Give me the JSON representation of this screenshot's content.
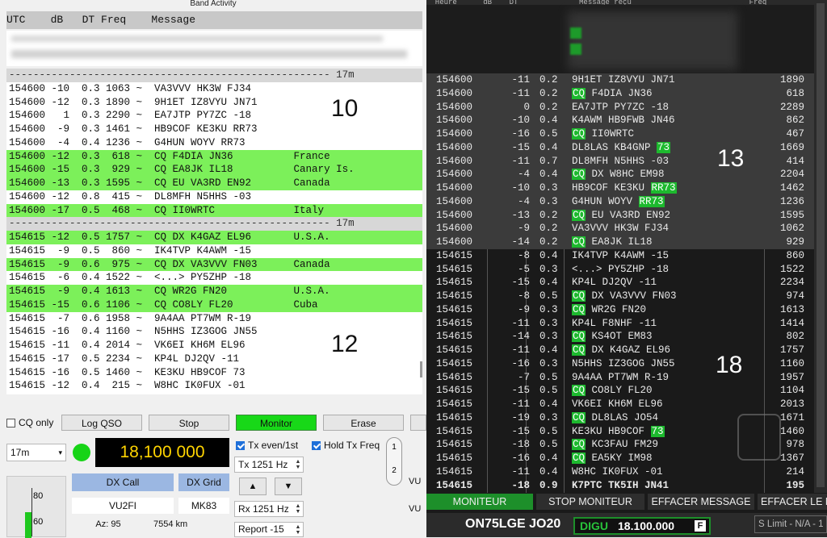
{
  "left": {
    "title": "Band Activity",
    "header": "UTC    dB   DT Freq    Message",
    "rows": [
      {
        "t": "----------------------------------------------------- 17m",
        "k": "sep"
      },
      {
        "t": "154600 -10  0.3 1063 ~  VA3VVV HK3W FJ34",
        "k": ""
      },
      {
        "t": "154600 -12  0.3 1890 ~  9H1ET IZ8VYU JN71",
        "k": ""
      },
      {
        "t": "154600   1  0.3 2290 ~  EA7JTP PY7ZC -18",
        "k": ""
      },
      {
        "t": "154600  -9  0.3 1461 ~  HB9COF KE3KU RR73",
        "k": ""
      },
      {
        "t": "154600  -4  0.4 1236 ~  G4HUN WOYV RR73",
        "k": ""
      },
      {
        "t": "154600 -12  0.3  618 ~  CQ F4DIA JN36          France",
        "k": "cq"
      },
      {
        "t": "154600 -15  0.3  929 ~  CQ EA8JK IL18          Canary Is.",
        "k": "cq"
      },
      {
        "t": "154600 -13  0.3 1595 ~  CQ EU VA3RD EN92       Canada",
        "k": "cq"
      },
      {
        "t": "154600 -12  0.8  415 ~  DL8MFH N5HHS -03",
        "k": ""
      },
      {
        "t": "154600 -17  0.5  468 ~  CQ II0WRTC             Italy",
        "k": "cq"
      },
      {
        "t": "----------------------------------------------------- 17m",
        "k": "sep"
      },
      {
        "t": "154615 -12  0.5 1757 ~  CQ DX K4GAZ EL96       U.S.A.",
        "k": "cq"
      },
      {
        "t": "154615  -9  0.5  860 ~  IK4TVP K4AWM -15",
        "k": ""
      },
      {
        "t": "154615  -9  0.6  975 ~  CQ DX VA3VVV FN03      Canada",
        "k": "cq"
      },
      {
        "t": "154615  -6  0.4 1522 ~  <...> PY5ZHP -18",
        "k": ""
      },
      {
        "t": "154615  -9  0.4 1613 ~  CQ WR2G FN20           U.S.A.",
        "k": "cq"
      },
      {
        "t": "154615 -15  0.6 1106 ~  CQ CO8LY FL20          Cuba",
        "k": "cq"
      },
      {
        "t": "154615  -7  0.6 1958 ~  9A4AA PT7WM R-19",
        "k": ""
      },
      {
        "t": "154615 -16  0.4 1160 ~  N5HHS IZ3GOG JN55",
        "k": ""
      },
      {
        "t": "154615 -11  0.4 2014 ~  VK6EI KH6M EL96",
        "k": ""
      },
      {
        "t": "154615 -17  0.5 2234 ~  KP4L DJ2QV -11",
        "k": ""
      },
      {
        "t": "154615 -16  0.5 1460 ~  KE3KU HB9COF 73",
        "k": ""
      },
      {
        "t": "154615 -12  0.4  215 ~  W8HC IK0FUX -01",
        "k": ""
      }
    ],
    "n10": "10",
    "n12": "12",
    "cq_only": "CQ only",
    "log_qso": "Log QSO",
    "stop": "Stop",
    "monitor": "Monitor",
    "erase": "Erase",
    "band": "17m",
    "freq": "18,100 000",
    "tx_even": "Tx even/1st",
    "hold_tx": "Hold Tx Freq",
    "tx": "Tx  1251 Hz",
    "rx": "Rx  1251 Hz",
    "report": "Report -15",
    "dx_call_lbl": "DX Call",
    "dx_grid_lbl": "DX Grid",
    "dx_call": "VU2FI",
    "dx_grid": "MK83",
    "az": "Az: 95",
    "dist": "7554 km",
    "meter_80": "80",
    "meter_60": "60",
    "tab_1": "1",
    "tab_2": "2",
    "vu": "VU"
  },
  "right": {
    "colhdr": "  Heure      dB    DT              Message reçu                           Fréq",
    "rows": [
      {
        "u": "154600",
        "db": "-11",
        "dt": "0.2",
        "m": [
          {
            "x": "9H1ET IZ8VYU JN71"
          }
        ],
        "f": "1890",
        "h": true
      },
      {
        "u": "154600",
        "db": "-11",
        "dt": "0.2",
        "m": [
          {
            "x": "CQ",
            "g": true
          },
          {
            "x": " F4DIA JN36"
          }
        ],
        "f": "618",
        "h": true
      },
      {
        "u": "154600",
        "db": "0",
        "dt": "0.2",
        "m": [
          {
            "x": "EA7JTP PY7ZC -18"
          }
        ],
        "f": "2289",
        "h": true
      },
      {
        "u": "154600",
        "db": "-10",
        "dt": "0.4",
        "m": [
          {
            "x": "K4AWM HB9FWB JN46"
          }
        ],
        "f": "862",
        "h": true
      },
      {
        "u": "154600",
        "db": "-16",
        "dt": "0.5",
        "m": [
          {
            "x": "CQ",
            "g": true
          },
          {
            "x": " II0WRTC"
          }
        ],
        "f": "467",
        "h": true
      },
      {
        "u": "154600",
        "db": "-15",
        "dt": "0.4",
        "m": [
          {
            "x": "DL8LAS KB4GNP "
          },
          {
            "x": "73",
            "g": true
          }
        ],
        "f": "1669",
        "h": true
      },
      {
        "u": "154600",
        "db": "-11",
        "dt": "0.7",
        "m": [
          {
            "x": "DL8MFH N5HHS -03"
          }
        ],
        "f": "414",
        "h": true
      },
      {
        "u": "154600",
        "db": "-4",
        "dt": "0.4",
        "m": [
          {
            "x": "CQ",
            "g": true
          },
          {
            "x": " DX W8HC EM98"
          }
        ],
        "f": "2204",
        "h": true
      },
      {
        "u": "154600",
        "db": "-10",
        "dt": "0.3",
        "m": [
          {
            "x": "HB9COF KE3KU "
          },
          {
            "x": "RR73",
            "g": true
          }
        ],
        "f": "1462",
        "h": true
      },
      {
        "u": "154600",
        "db": "-4",
        "dt": "0.3",
        "m": [
          {
            "x": "G4HUN WOYV "
          },
          {
            "x": "RR73",
            "g": true
          }
        ],
        "f": "1236",
        "h": true
      },
      {
        "u": "154600",
        "db": "-13",
        "dt": "0.2",
        "m": [
          {
            "x": "CQ",
            "g": true
          },
          {
            "x": " EU VA3RD EN92"
          }
        ],
        "f": "1595",
        "h": true
      },
      {
        "u": "154600",
        "db": "-9",
        "dt": "0.2",
        "m": [
          {
            "x": "VA3VVV HK3W FJ34"
          }
        ],
        "f": "1062",
        "h": true
      },
      {
        "u": "154600",
        "db": "-14",
        "dt": "0.2",
        "m": [
          {
            "x": "CQ",
            "g": true
          },
          {
            "x": " EA8JK IL18"
          }
        ],
        "f": "929",
        "h": true
      },
      {
        "u": "154615",
        "db": "-8",
        "dt": "0.4",
        "m": [
          {
            "x": "IK4TVP K4AWM -15"
          }
        ],
        "f": "860",
        "h": false
      },
      {
        "u": "154615",
        "db": "-5",
        "dt": "0.3",
        "m": [
          {
            "x": "<...> PY5ZHP -18"
          }
        ],
        "f": "1522",
        "h": false
      },
      {
        "u": "154615",
        "db": "-15",
        "dt": "0.4",
        "m": [
          {
            "x": "KP4L DJ2QV -11"
          }
        ],
        "f": "2234",
        "h": false
      },
      {
        "u": "154615",
        "db": "-8",
        "dt": "0.5",
        "m": [
          {
            "x": "CQ",
            "g": true
          },
          {
            "x": " DX VA3VVV FN03"
          }
        ],
        "f": "974",
        "h": false
      },
      {
        "u": "154615",
        "db": "-9",
        "dt": "0.3",
        "m": [
          {
            "x": "CQ",
            "g": true
          },
          {
            "x": " WR2G FN20"
          }
        ],
        "f": "1613",
        "h": false
      },
      {
        "u": "154615",
        "db": "-11",
        "dt": "0.3",
        "m": [
          {
            "x": "KP4L F8NHF -11"
          }
        ],
        "f": "1414",
        "h": false
      },
      {
        "u": "154615",
        "db": "-14",
        "dt": "0.3",
        "m": [
          {
            "x": "CQ",
            "g": true
          },
          {
            "x": " KS4OT EM83"
          }
        ],
        "f": "802",
        "h": false
      },
      {
        "u": "154615",
        "db": "-11",
        "dt": "0.4",
        "m": [
          {
            "x": "CQ",
            "g": true
          },
          {
            "x": " DX K4GAZ EL96"
          }
        ],
        "f": "1757",
        "h": false
      },
      {
        "u": "154615",
        "db": "-16",
        "dt": "0.3",
        "m": [
          {
            "x": "N5HHS IZ3GOG JN55"
          }
        ],
        "f": "1160",
        "h": false
      },
      {
        "u": "154615",
        "db": "-7",
        "dt": "0.5",
        "m": [
          {
            "x": "9A4AA PT7WM R-19"
          }
        ],
        "f": "1957",
        "h": false
      },
      {
        "u": "154615",
        "db": "-15",
        "dt": "0.5",
        "m": [
          {
            "x": "CQ",
            "g": true
          },
          {
            "x": " CO8LY FL20"
          }
        ],
        "f": "1104",
        "h": false
      },
      {
        "u": "154615",
        "db": "-11",
        "dt": "0.4",
        "m": [
          {
            "x": "VK6EI KH6M EL96"
          }
        ],
        "f": "2013",
        "h": false
      },
      {
        "u": "154615",
        "db": "-19",
        "dt": "0.3",
        "m": [
          {
            "x": "CQ",
            "g": true
          },
          {
            "x": " DL8LAS JO54"
          }
        ],
        "f": "1671",
        "h": false
      },
      {
        "u": "154615",
        "db": "-15",
        "dt": "0.5",
        "m": [
          {
            "x": "KE3KU HB9COF "
          },
          {
            "x": "73",
            "g": true
          }
        ],
        "f": "1460",
        "h": false
      },
      {
        "u": "154615",
        "db": "-18",
        "dt": "0.5",
        "m": [
          {
            "x": "CQ",
            "g": true
          },
          {
            "x": " KC3FAU FM29"
          }
        ],
        "f": "978",
        "h": false
      },
      {
        "u": "154615",
        "db": "-16",
        "dt": "0.4",
        "m": [
          {
            "x": "CQ",
            "g": true
          },
          {
            "x": " EA5KY IM98"
          }
        ],
        "f": "1367",
        "h": false
      },
      {
        "u": "154615",
        "db": "-11",
        "dt": "0.4",
        "m": [
          {
            "x": "W8HC IK0FUX -01"
          }
        ],
        "f": "214",
        "h": false
      },
      {
        "u": "154615",
        "db": "-18",
        "dt": "0.9",
        "m": [
          {
            "x": "K7PTC TK5IH JN41"
          }
        ],
        "f": "195",
        "h": false,
        "b": true
      }
    ],
    "n13": "13",
    "n18": "18",
    "tab_monitor": "MONITEUR",
    "tab_stop": "STOP MONITEUR",
    "tab_erase": "EFFACER MESSAGE",
    "tab_erase2": "EFFACER LE M",
    "callsign": "ON75LGE JO20",
    "mode": "DIGU",
    "freq": "18.100.000",
    "f_icon": "F",
    "slimit": "S Limit - N/A - 1"
  },
  "colors": {
    "cq_green": "#7cf05a",
    "dark_green": "#1d8f2a",
    "tag_green": "#1db92e"
  }
}
